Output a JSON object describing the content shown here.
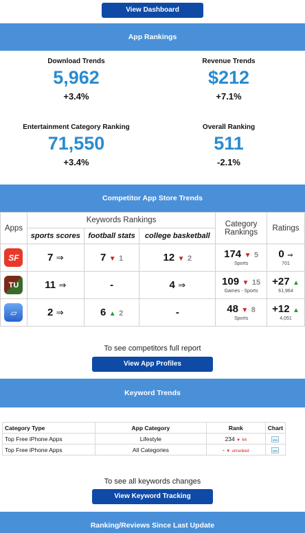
{
  "top_button": "View Dashboard",
  "app_rankings": {
    "title": "App Rankings",
    "download": {
      "label": "Download Trends",
      "value": "5,962",
      "change": "+3.4%"
    },
    "revenue": {
      "label": "Revenue Trends",
      "value": "$212",
      "change": "+7.1%"
    },
    "entertainment": {
      "label": "Entertainment Category Ranking",
      "value": "71,550",
      "change": "+3.4%"
    },
    "overall": {
      "label": "Overall Ranking",
      "value": "511",
      "change": "-2.1%"
    }
  },
  "competitor": {
    "title": "Competitor App Store Trends",
    "headers": {
      "apps": "Apps",
      "keywords": "Keywords Rankings",
      "category": "Category Rankings",
      "ratings": "Ratings"
    },
    "keywords": [
      "sports scores",
      "football stats",
      "college basketball"
    ],
    "rows": [
      {
        "icon_text": "SF",
        "icon_color": "#e8382a",
        "k1": "7",
        "k1_arrow": "⇒",
        "k2": "7",
        "k2_arrow": "▼",
        "k2_delta": "1",
        "k3": "12",
        "k3_arrow": "▼",
        "k3_delta": "2",
        "cat": "174",
        "cat_arrow": "▼",
        "cat_delta": "5",
        "cat_sub": "Sports",
        "rating": "0",
        "rating_arrow": "⇒",
        "rating_sub": "701"
      },
      {
        "icon_text": "TU",
        "icon_color": "#5a4a2a",
        "k1": "11",
        "k1_arrow": "⇒",
        "k2": "-",
        "k3": "4",
        "k3_arrow": "⇒",
        "cat": "109",
        "cat_arrow": "▼",
        "cat_delta": "15",
        "cat_sub": "Games - Sports",
        "rating": "+27",
        "rating_arrow": "▲",
        "rating_sub": "61,964"
      },
      {
        "icon_text": "▱",
        "icon_color": "#3a78e0",
        "k1": "2",
        "k1_arrow": "⇒",
        "k2": "6",
        "k2_arrow": "▲",
        "k2_delta": "2",
        "k3": "-",
        "cat": "48",
        "cat_arrow": "▼",
        "cat_delta": "8",
        "cat_sub": "Sports",
        "rating": "+12",
        "rating_arrow": "▲",
        "rating_sub": "4,051"
      }
    ],
    "note": "To see competitors full report",
    "button": "View App Profiles"
  },
  "keyword_trends": {
    "title": "Keyword Trends",
    "headers": [
      "Category Type",
      "App Category",
      "Rank",
      "Chart"
    ],
    "rows": [
      {
        "type": "Top Free iPhone Apps",
        "category": "Lifestyle",
        "rank": "234",
        "arrow": "▼",
        "delta": "64"
      },
      {
        "type": "Top Free iPhone Apps",
        "category": "All Categories",
        "rank": "-",
        "arrow": "▼",
        "delta": "unranked"
      }
    ],
    "note": "To see all keywords changes",
    "button": "View Keyword Tracking"
  },
  "bottom_section": {
    "title": "Ranking/Reviews Since Last Update"
  }
}
